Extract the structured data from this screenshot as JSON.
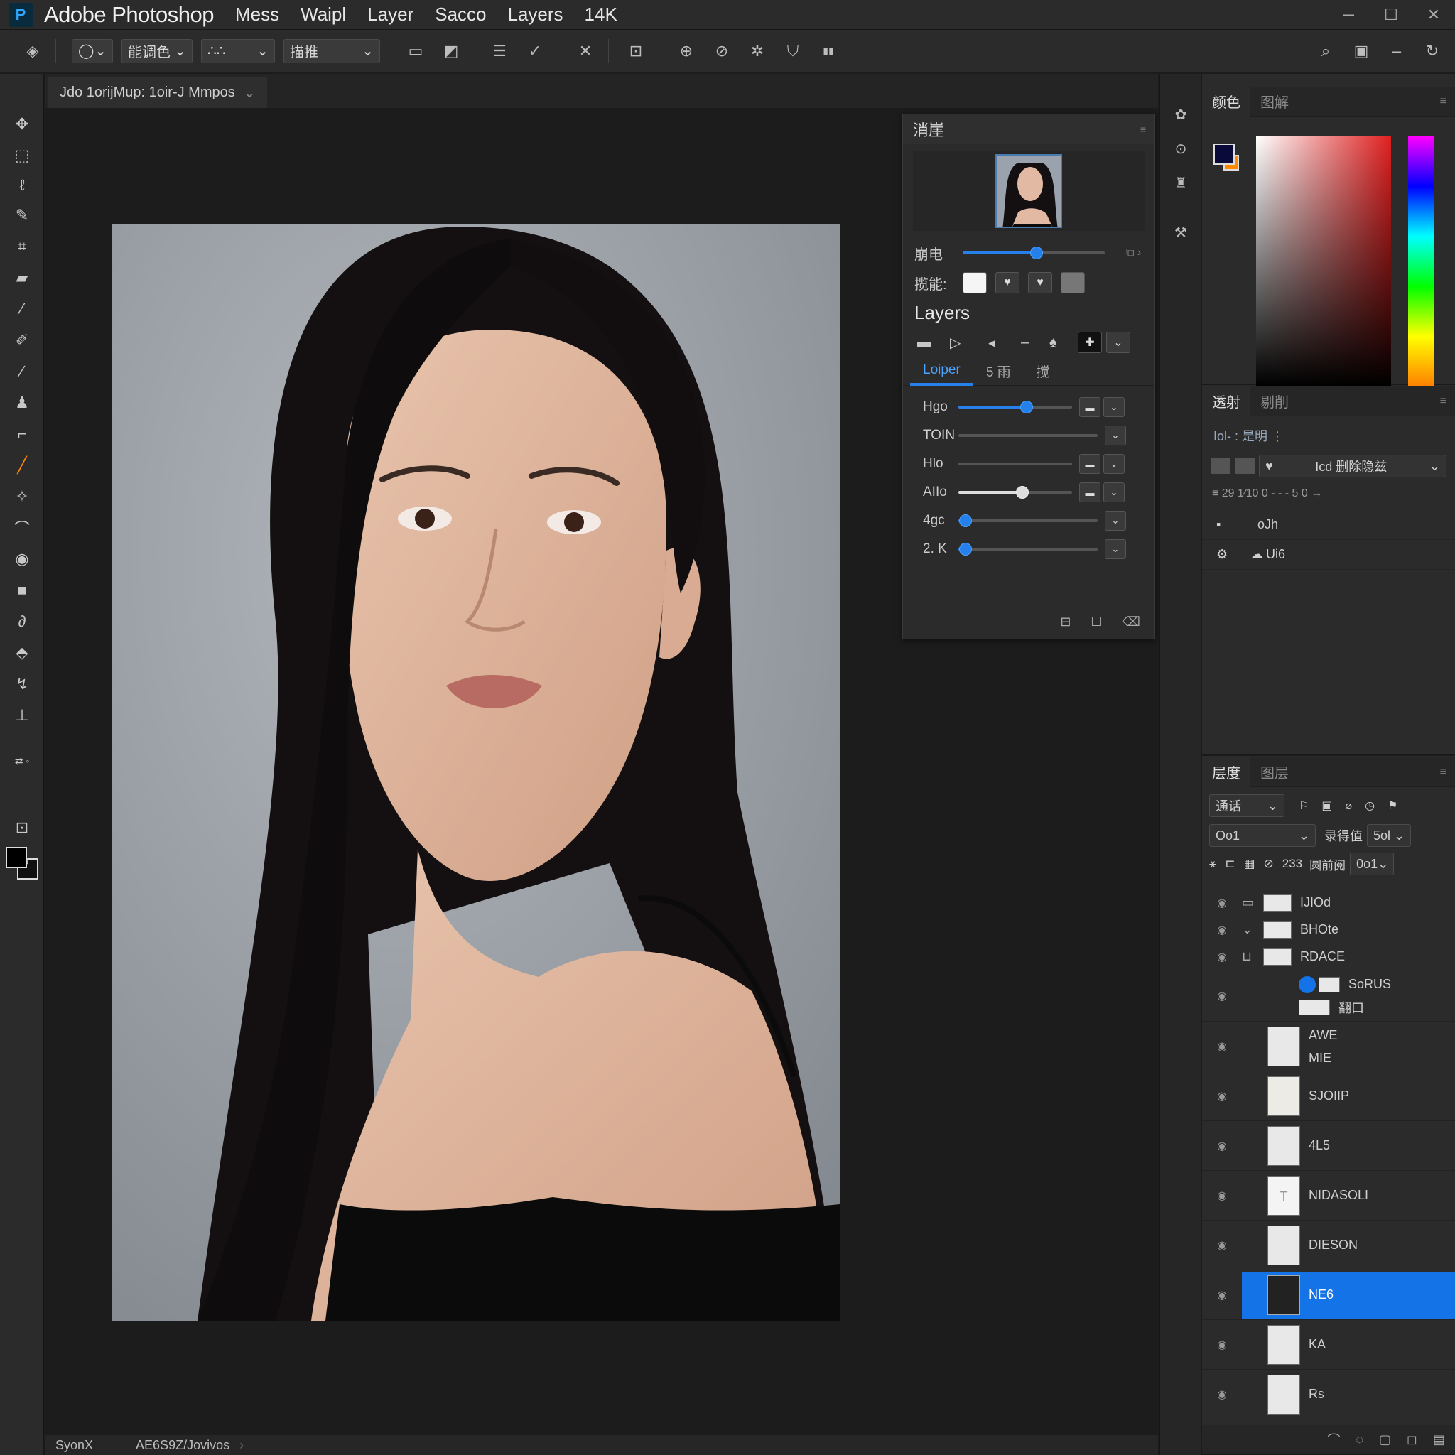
{
  "title_bar": {
    "logo": "P",
    "app_title": "Adobe Photoshop",
    "menu": [
      "Mess",
      "Waipl",
      "Layer",
      "Sacco",
      "Layers",
      "14K"
    ]
  },
  "options_bar": {
    "select1": "能调色",
    "select2": "∴∴",
    "select3": "描推"
  },
  "document": {
    "tab_title": "Jdo 1orijMup: 1oir-J Mmpos",
    "status_left": "SyonX",
    "status_right": "AE6S9Z/Jovivos"
  },
  "float_panel": {
    "title": "消崖",
    "row1_label": "崩电",
    "row1_value": 0.52,
    "row2_label": "揽能:",
    "layers_heading": "Layers",
    "tabs": [
      "Loiper",
      "5 雨",
      "搅"
    ],
    "adjustments": [
      {
        "label": "Hgo",
        "value": 0.6
      },
      {
        "label": "TOIN",
        "value": 0.0
      },
      {
        "label": "Hlo",
        "value": 0.0
      },
      {
        "label": "AIIo",
        "value": 0.56
      },
      {
        "label": "4gc",
        "value": 0.05
      },
      {
        "label": "2. K",
        "value": 0.05
      }
    ]
  },
  "color_panel": {
    "tabs": [
      "颜色",
      "图解"
    ],
    "fg_color": "#0a0a3a",
    "bg_color": "#ff8a00"
  },
  "adjust_panel": {
    "tabs": [
      "透射",
      "剔削"
    ],
    "subtitle": "Iol- : 是明 ⋮",
    "dropdown": "Icd 删除隐兹",
    "row_text": "≡ 29 1⁄10 0 - - - 5  0  →",
    "items": [
      "oJh",
      "Ui6"
    ]
  },
  "layers_panel": {
    "tabs": [
      "层度",
      "图层"
    ],
    "blend_mode": "通话",
    "kind_select": "Oo1",
    "opacity_label": "录得值",
    "opacity_value": "5ol",
    "fill_label": "圆前阅",
    "fill_value": "0o1",
    "lock_count": "233",
    "layers": [
      {
        "name": "IJIOd",
        "visible": true
      },
      {
        "name": "BHOte",
        "visible": true
      },
      {
        "name": "RDACE",
        "visible": true
      },
      {
        "name": "SoRUS",
        "visible": true
      },
      {
        "name": "翻口",
        "visible": true
      },
      {
        "name": "AWE",
        "visible": true
      },
      {
        "name": "MIE",
        "visible": true
      },
      {
        "name": "SJOIIP",
        "visible": true
      },
      {
        "name": "4L5",
        "visible": true
      },
      {
        "name": "NIDASOLI",
        "visible": true
      },
      {
        "name": "DIESON",
        "visible": true
      },
      {
        "name": "NE6",
        "visible": true,
        "selected": true
      },
      {
        "name": "KA",
        "visible": true
      },
      {
        "name": "Rs",
        "visible": true
      }
    ]
  }
}
